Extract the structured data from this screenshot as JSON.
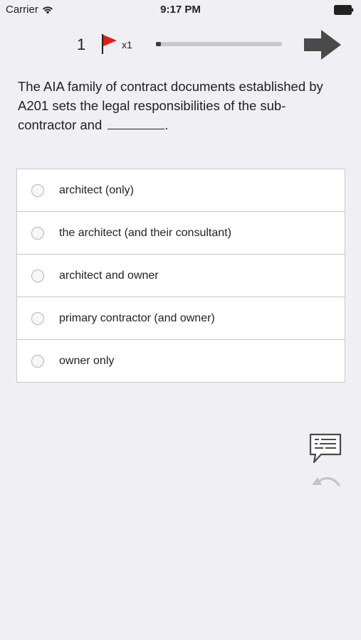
{
  "status_bar": {
    "carrier": "Carrier",
    "time": "9:17 PM"
  },
  "quiz": {
    "question_number": "1",
    "flag_count": "x1",
    "progress_fraction": 0.04,
    "flag_color": "#e41b17"
  },
  "question": {
    "text": "The AIA family of contract documents established by A201 sets the legal responsibilities of the sub-contractor and",
    "end_punctuation": "."
  },
  "answers": [
    {
      "label": "architect (only)",
      "selected": false
    },
    {
      "label": "the architect (and their consultant)",
      "selected": false
    },
    {
      "label": "architect and owner",
      "selected": false
    },
    {
      "label": "primary contractor (and owner)",
      "selected": false
    },
    {
      "label": "owner only",
      "selected": false
    }
  ],
  "icons": {
    "next": "arrow-right-icon",
    "comment": "comment-icon",
    "undo": "undo-icon"
  }
}
